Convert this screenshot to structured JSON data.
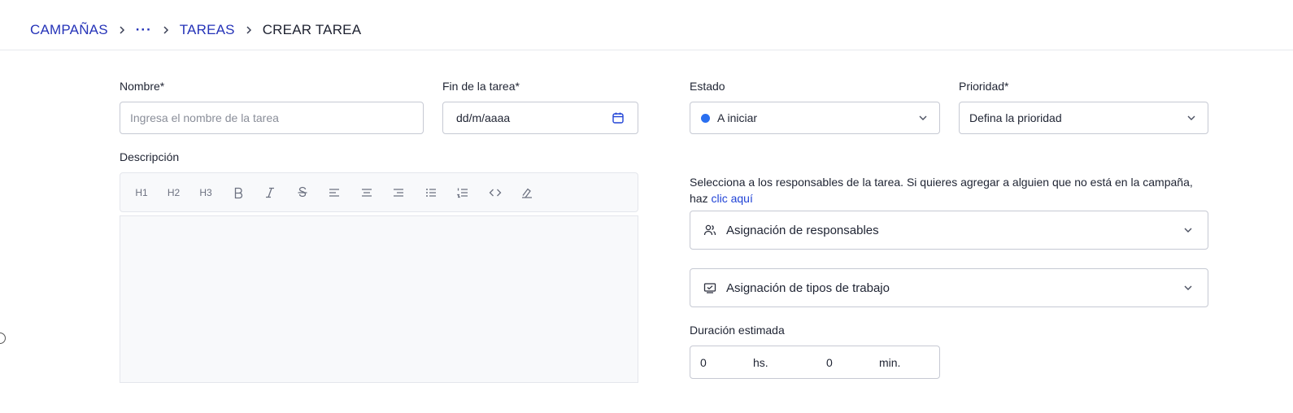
{
  "breadcrumb": {
    "items": [
      "CAMPAÑAS",
      "···",
      "TAREAS",
      "CREAR TAREA"
    ]
  },
  "form": {
    "name": {
      "label": "Nombre",
      "required_mark": "*",
      "placeholder": "Ingresa el nombre de la tarea"
    },
    "end_date": {
      "label": "Fin de la tarea",
      "required_mark": "*",
      "value": "dd/m/aaaa"
    },
    "status": {
      "label": "Estado",
      "value": "A iniciar",
      "dot_color": "#2a6ff0"
    },
    "priority": {
      "label": "Prioridad",
      "required_mark": "*",
      "value": "Defina la prioridad"
    },
    "description": {
      "label": "Descripción",
      "toolbar": [
        "heading-1",
        "heading-2",
        "heading-3",
        "bold",
        "italic",
        "strikethrough",
        "align-left",
        "align-center",
        "align-right",
        "bullet-list",
        "ordered-list",
        "code",
        "clear-format"
      ],
      "heading_labels": [
        "H1",
        "H2",
        "H3"
      ]
    },
    "responsibles": {
      "help_text": "Selecciona a los responsables de la tarea. Si quieres agregar a alguien que no está en la campaña, haz",
      "help_link": "clic aquí",
      "assign_label": "Asignación de responsables"
    },
    "work_types": {
      "assign_label": "Asignación de tipos de trabajo"
    },
    "duration": {
      "label": "Duración estimada",
      "hours_value": "0",
      "hours_unit": "hs.",
      "minutes_value": "0",
      "minutes_unit": "min."
    }
  },
  "colors": {
    "link": "#2533b8",
    "accent": "#2043d6",
    "border": "#c6c9d3"
  }
}
